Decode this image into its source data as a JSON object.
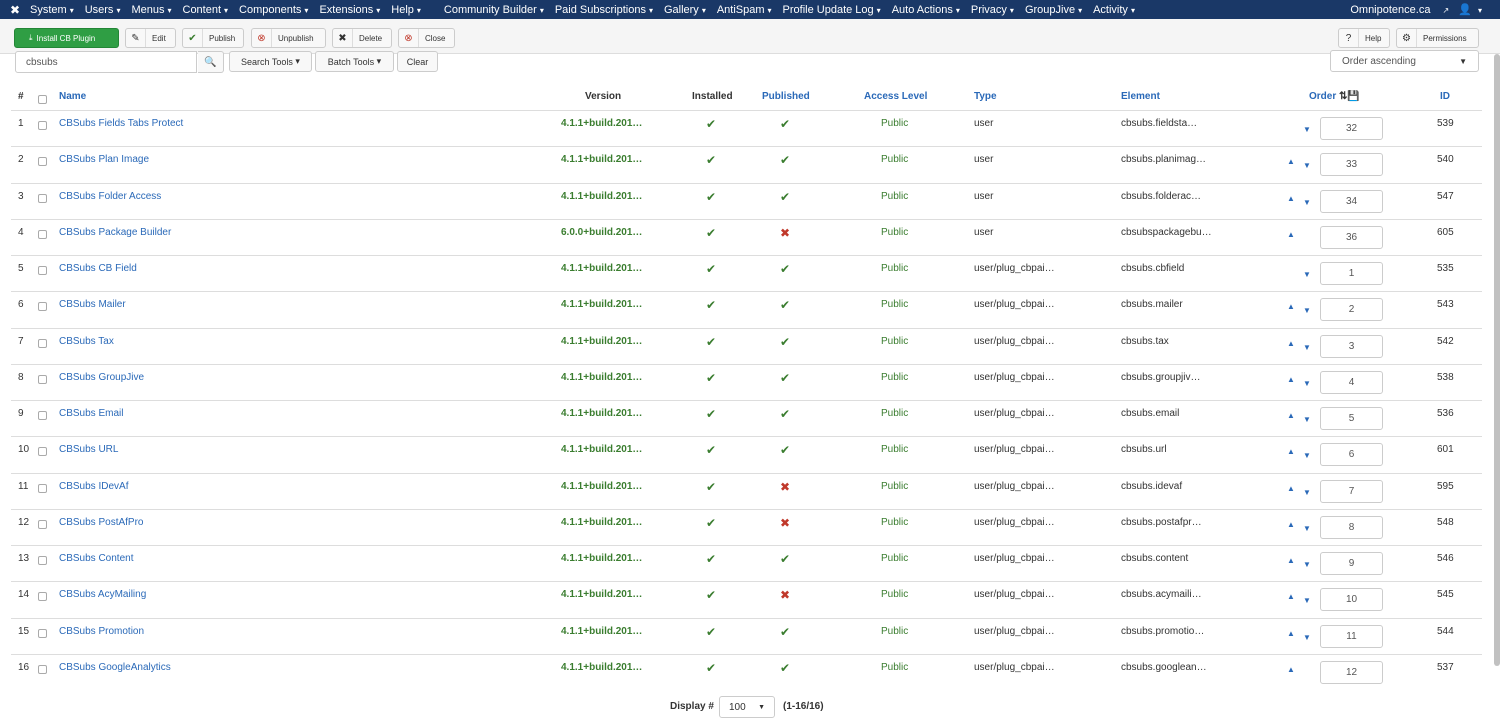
{
  "nav": {
    "logo": "✖",
    "menus": [
      "System",
      "Users",
      "Menus",
      "Content",
      "Components",
      "Extensions",
      "Help",
      "Community Builder",
      "Paid Subscriptions",
      "Gallery",
      "AntiSpam",
      "Profile Update Log",
      "Auto Actions",
      "Privacy",
      "GroupJive",
      "Activity"
    ],
    "site_link": "Omnipotence.ca",
    "user_icon": "user-icon"
  },
  "toolbar": {
    "install_label": "Install CB Plugin",
    "edit_label": "Edit",
    "publish_label": "Publish",
    "unpublish_label": "Unpublish",
    "delete_label": "Delete",
    "close_label": "Close",
    "help_label": "Help",
    "permissions_label": "Permissions"
  },
  "filters": {
    "search_value": "cbsubs",
    "search_tools_label": "Search Tools",
    "batch_tools_label": "Batch Tools",
    "clear_label": "Clear",
    "order_value": "Order ascending"
  },
  "columns": {
    "num": "#",
    "name": "Name",
    "version": "Version",
    "installed": "Installed",
    "published": "Published",
    "access": "Access Level",
    "type": "Type",
    "element": "Element",
    "order": "Order",
    "id": "ID"
  },
  "rows": [
    {
      "num": "1",
      "name": "CBSubs Fields Tabs Protect",
      "version": "4.1.1+build.201…",
      "published": true,
      "access": "Public",
      "type": "user",
      "element": "cbsubs.fieldsta…",
      "up": false,
      "down": true,
      "order": "32",
      "id": "539"
    },
    {
      "num": "2",
      "name": "CBSubs Plan Image",
      "version": "4.1.1+build.201…",
      "published": true,
      "access": "Public",
      "type": "user",
      "element": "cbsubs.planimag…",
      "up": true,
      "down": true,
      "order": "33",
      "id": "540"
    },
    {
      "num": "3",
      "name": "CBSubs Folder Access",
      "version": "4.1.1+build.201…",
      "published": true,
      "access": "Public",
      "type": "user",
      "element": "cbsubs.folderac…",
      "up": true,
      "down": true,
      "order": "34",
      "id": "547"
    },
    {
      "num": "4",
      "name": "CBSubs Package Builder",
      "version": "6.0.0+build.201…",
      "published": false,
      "access": "Public",
      "type": "user",
      "element": "cbsubspackagebu…",
      "up": true,
      "down": false,
      "order": "36",
      "id": "605"
    },
    {
      "num": "5",
      "name": "CBSubs CB Field",
      "version": "4.1.1+build.201…",
      "published": true,
      "access": "Public",
      "type": "user/plug_cbpai…",
      "element": "cbsubs.cbfield",
      "up": false,
      "down": true,
      "order": "1",
      "id": "535"
    },
    {
      "num": "6",
      "name": "CBSubs Mailer",
      "version": "4.1.1+build.201…",
      "published": true,
      "access": "Public",
      "type": "user/plug_cbpai…",
      "element": "cbsubs.mailer",
      "up": true,
      "down": true,
      "order": "2",
      "id": "543"
    },
    {
      "num": "7",
      "name": "CBSubs Tax",
      "version": "4.1.1+build.201…",
      "published": true,
      "access": "Public",
      "type": "user/plug_cbpai…",
      "element": "cbsubs.tax",
      "up": true,
      "down": true,
      "order": "3",
      "id": "542"
    },
    {
      "num": "8",
      "name": "CBSubs GroupJive",
      "version": "4.1.1+build.201…",
      "published": true,
      "access": "Public",
      "type": "user/plug_cbpai…",
      "element": "cbsubs.groupjiv…",
      "up": true,
      "down": true,
      "order": "4",
      "id": "538"
    },
    {
      "num": "9",
      "name": "CBSubs Email",
      "version": "4.1.1+build.201…",
      "published": true,
      "access": "Public",
      "type": "user/plug_cbpai…",
      "element": "cbsubs.email",
      "up": true,
      "down": true,
      "order": "5",
      "id": "536"
    },
    {
      "num": "10",
      "name": "CBSubs URL",
      "version": "4.1.1+build.201…",
      "published": true,
      "access": "Public",
      "type": "user/plug_cbpai…",
      "element": "cbsubs.url",
      "up": true,
      "down": true,
      "order": "6",
      "id": "601"
    },
    {
      "num": "11",
      "name": "CBSubs IDevAf",
      "version": "4.1.1+build.201…",
      "published": false,
      "access": "Public",
      "type": "user/plug_cbpai…",
      "element": "cbsubs.idevaf",
      "up": true,
      "down": true,
      "order": "7",
      "id": "595"
    },
    {
      "num": "12",
      "name": "CBSubs PostAfPro",
      "version": "4.1.1+build.201…",
      "published": false,
      "access": "Public",
      "type": "user/plug_cbpai…",
      "element": "cbsubs.postafpr…",
      "up": true,
      "down": true,
      "order": "8",
      "id": "548"
    },
    {
      "num": "13",
      "name": "CBSubs Content",
      "version": "4.1.1+build.201…",
      "published": true,
      "access": "Public",
      "type": "user/plug_cbpai…",
      "element": "cbsubs.content",
      "up": true,
      "down": true,
      "order": "9",
      "id": "546"
    },
    {
      "num": "14",
      "name": "CBSubs AcyMailing",
      "version": "4.1.1+build.201…",
      "published": false,
      "access": "Public",
      "type": "user/plug_cbpai…",
      "element": "cbsubs.acymaili…",
      "up": true,
      "down": true,
      "order": "10",
      "id": "545"
    },
    {
      "num": "15",
      "name": "CBSubs Promotion",
      "version": "4.1.1+build.201…",
      "published": true,
      "access": "Public",
      "type": "user/plug_cbpai…",
      "element": "cbsubs.promotio…",
      "up": true,
      "down": true,
      "order": "11",
      "id": "544"
    },
    {
      "num": "16",
      "name": "CBSubs GoogleAnalytics",
      "version": "4.1.1+build.201…",
      "published": true,
      "access": "Public",
      "type": "user/plug_cbpai…",
      "element": "cbsubs.googlean…",
      "up": true,
      "down": false,
      "order": "12",
      "id": "537"
    }
  ],
  "footer": {
    "display_label": "Display #",
    "display_value": "100",
    "count_text": "(1-16/16)"
  },
  "colors": {
    "nav_bg": "#1a3867",
    "link": "#2a69b8",
    "green": "#3a7d2f",
    "red": "#c0392b",
    "install_bg": "#2f9e44"
  }
}
